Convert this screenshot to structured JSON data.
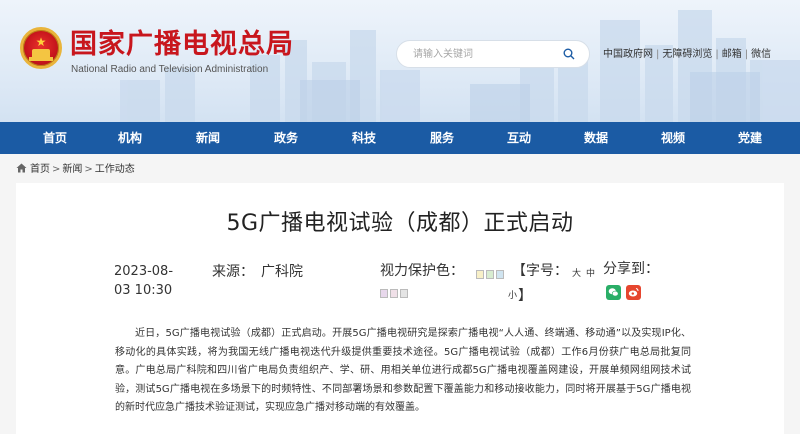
{
  "header": {
    "site_title": "国家广播电视总局",
    "site_subtitle": "National Radio and Television Administration",
    "search_placeholder": "请输入关键词",
    "top_links": [
      "中国政府网",
      "无障碍浏览",
      "邮箱",
      "微信"
    ]
  },
  "nav": {
    "items": [
      "首页",
      "机构",
      "新闻",
      "政务",
      "科技",
      "服务",
      "互动",
      "数据",
      "视频",
      "党建"
    ]
  },
  "breadcrumb": {
    "items": [
      "首页",
      "新闻",
      "工作动态"
    ],
    "separator": ">"
  },
  "article": {
    "title": "5G广播电视试验（成都）正式启动",
    "date": "2023-08-03 10:30",
    "source_label": "来源：",
    "source": "广科院",
    "eye_protection_label": "视力保护色：",
    "eye_colors": [
      "#f8f0c8",
      "#d8ecd0",
      "#d0e4f0",
      "#e8d8ec",
      "#f0e0e8",
      "#e4e4e4"
    ],
    "font_size_label": "【字号：",
    "font_size_big": "大",
    "font_size_mid": "中",
    "font_size_small": "小",
    "font_size_close": "】",
    "share_label": "分享到：",
    "body": "近日，5G广播电视试验（成都）正式启动。开展5G广播电视研究是探索广播电视“人人通、终端通、移动通”以及实现IP化、移动化的具体实践，将为我国无线广播电视迭代升级提供重要技术途径。5G广播电视试验（成都）工作6月份获广电总局批复同意。广电总局广科院和四川省广电局负责组织产、学、研、用相关单位进行成都5G广播电视覆盖网建设，开展单频网组网技术试验，测试5G广播电视在多场景下的时频特性、不同部署场景和参数配置下覆盖能力和移动接收能力，同时将开展基于5G广播电视的新时代应急广播技术验证测试，实现应急广播对移动端的有效覆盖。"
  },
  "colors": {
    "brand_red": "#c8161d",
    "nav_blue": "#1b5ba4",
    "wechat_green": "#2aae67",
    "weibo_red": "#e6462f"
  }
}
